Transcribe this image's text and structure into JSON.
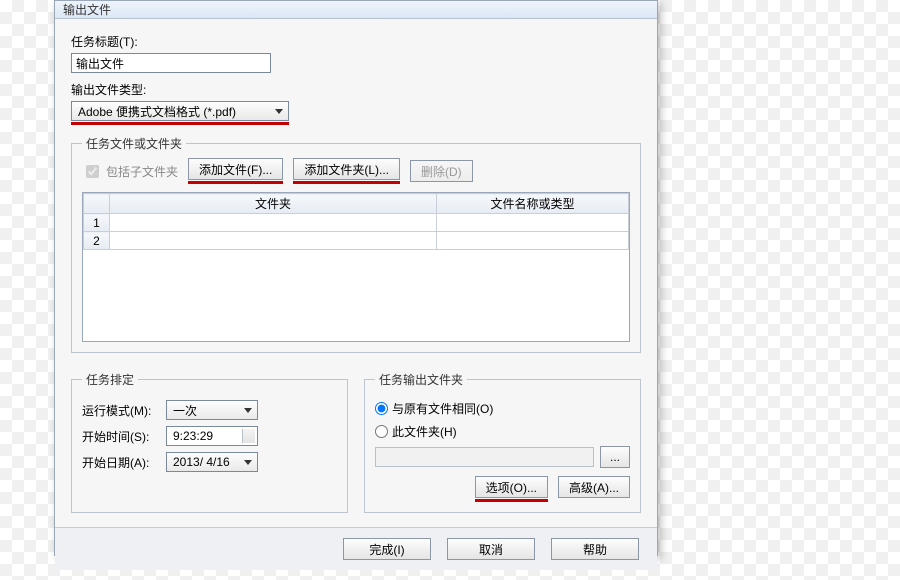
{
  "titlebar": {
    "text": "输出文件"
  },
  "task_title": {
    "label": "任务标题(T):",
    "value": "输出文件"
  },
  "output_type": {
    "label": "输出文件类型:",
    "value": "Adobe 便携式文档格式 (*.pdf)"
  },
  "files_group": {
    "legend": "任务文件或文件夹",
    "include_sub": "包括子文件夹",
    "add_file": "添加文件(F)...",
    "add_folder": "添加文件夹(L)...",
    "delete": "删除(D)",
    "col_folder": "文件夹",
    "col_name": "文件名称或类型",
    "row1": "1",
    "row2": "2"
  },
  "schedule": {
    "legend": "任务排定",
    "run_mode_label": "运行模式(M):",
    "run_mode_value": "一次",
    "start_time_label": "开始时间(S):",
    "start_time_value": "9:23:29",
    "start_date_label": "开始日期(A):",
    "start_date_value": "2013/ 4/16"
  },
  "output_folder": {
    "legend": "任务输出文件夹",
    "same_as_src": "与原有文件相同(O)",
    "this_folder": "此文件夹(H)",
    "browse": "..."
  },
  "right_btns": {
    "options": "选项(O)...",
    "advanced": "高级(A)..."
  },
  "footer": {
    "finish": "完成(I)",
    "cancel": "取消",
    "help": "帮助"
  }
}
